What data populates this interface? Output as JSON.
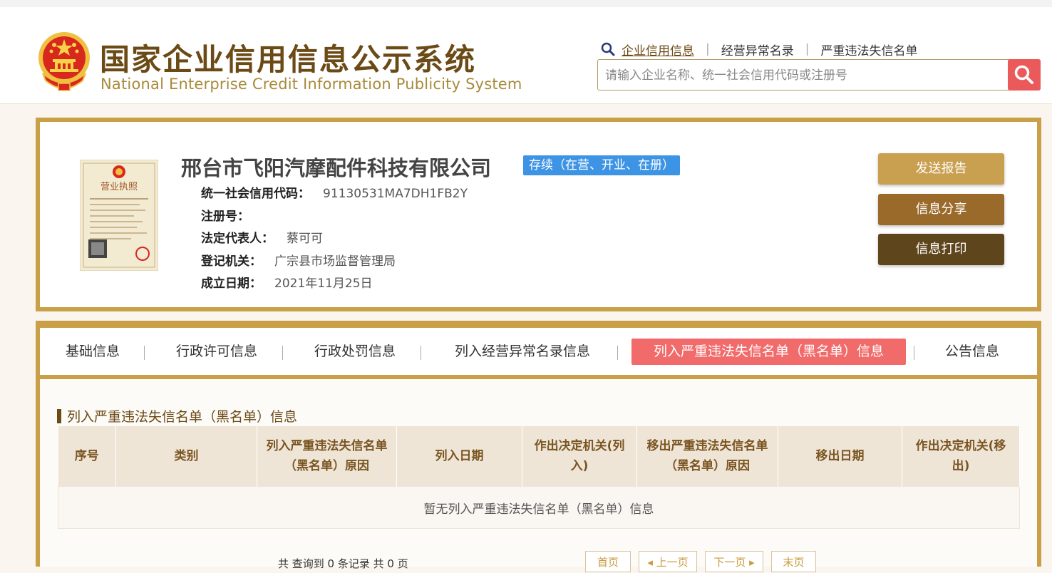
{
  "header": {
    "title_cn": "国家企业信用信息公示系统",
    "title_en": "National Enterprise Credit Information Publicity System",
    "links": [
      "企业信用信息",
      "经营异常名录",
      "严重违法失信名单"
    ],
    "search_placeholder": "请输入企业名称、统一社会信用代码或注册号",
    "accent_color": "#6b4a16",
    "search_button_color": "#ea5a5a"
  },
  "company": {
    "name": "邢台市飞阳汽摩配件科技有限公司",
    "status": "存续（在营、开业、在册）",
    "license_image_title": "营业执照",
    "fields": [
      {
        "label": "统一社会信用代码：",
        "value": "91130531MA7DH1FB2Y"
      },
      {
        "label": "注册号：",
        "value": ""
      },
      {
        "label": "法定代表人：",
        "value": "蔡可可"
      },
      {
        "label": "登记机关：",
        "value": "广宗县市场监督管理局"
      },
      {
        "label": "成立日期：",
        "value": "2021年11月25日"
      }
    ],
    "actions": [
      {
        "label": "发送报告",
        "color": "#c9a050"
      },
      {
        "label": "信息分享",
        "color": "#9a6a2a"
      },
      {
        "label": "信息打印",
        "color": "#5e451c"
      }
    ]
  },
  "tabs": [
    {
      "label": "基础信息"
    },
    {
      "label": "行政许可信息"
    },
    {
      "label": "行政处罚信息"
    },
    {
      "label": "列入经营异常名录信息"
    },
    {
      "label": "列入严重违法失信名单（黑名单）信息"
    },
    {
      "label": "公告信息"
    }
  ],
  "section": {
    "title": "列入严重违法失信名单（黑名单）信息",
    "columns": [
      "序号",
      "类别",
      "列入严重违法失信名单（黑名单）原因",
      "列入日期",
      "作出决定机关(列入)",
      "移出严重违法失信名单（黑名单）原因",
      "移出日期",
      "作出决定机关(移出)"
    ],
    "empty_text": "暂无列入严重违法失信名单（黑名单）信息"
  },
  "pager": {
    "summary": "共 查询到 0 条记录 共 0 页",
    "first": "首页",
    "prev": "◂ 上一页",
    "next": "下一页 ▸",
    "last": "末页"
  }
}
